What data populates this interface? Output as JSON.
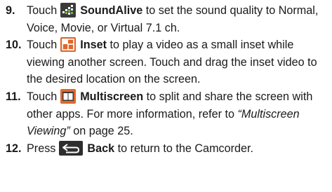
{
  "items": [
    {
      "number": "9.",
      "lead": "Touch ",
      "icon": "soundalive-icon",
      "bold": "SoundAlive",
      "rest": " to set the sound quality to Normal, Voice, Movie, or Virtual 7.1 ch."
    },
    {
      "number": "10.",
      "lead": "Touch ",
      "icon": "inset-icon",
      "bold": "Inset",
      "rest": " to play a video as a small inset while viewing another screen. Touch and drag the inset video to the desired location on the screen."
    },
    {
      "number": "11.",
      "lead": "Touch ",
      "icon": "multiscreen-icon",
      "bold": "Multiscreen",
      "rest": " to split and share the screen with other apps. For more information, refer to ",
      "italic": "“Multiscreen Viewing”",
      "rest2": " on page 25."
    },
    {
      "number": "12.",
      "lead": "Press ",
      "icon": "back-icon",
      "bold": "Back",
      "rest": " to return to the Camcorder."
    }
  ],
  "colors": {
    "text": "#1a1a1a",
    "icon_dark": "#3a3a3a",
    "icon_grid_green": "#6fbf3a",
    "icon_orange": "#e0672a",
    "icon_back_bg": "#2e2e2e"
  }
}
